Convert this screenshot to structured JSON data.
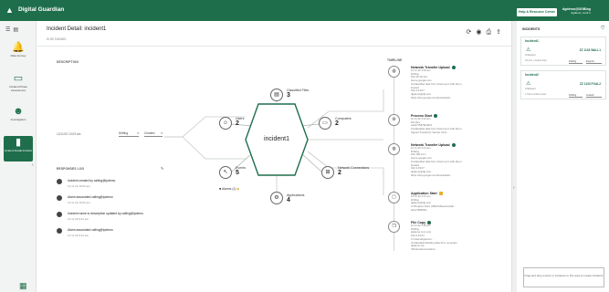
{
  "app": {
    "title": "Digital Guardian",
    "logo_icon": "triangle-logo-icon"
  },
  "topbar": {
    "help_label": "Help & Resource Center",
    "user_name": "dgdemo@DGBlog",
    "user_sub": "dgdemo, Lock 1"
  },
  "nav": {
    "items": [
      {
        "label": "Data Gurvey",
        "icon": "bell-icon"
      },
      {
        "label": "Incident Phase Assessment",
        "icon": "monitor-icon"
      },
      {
        "label": "Investigation",
        "icon": "person-search-icon"
      },
      {
        "label": "Incident Detail Incident",
        "icon": "document-icon"
      }
    ]
  },
  "page": {
    "title": "Incident Detail: incident1",
    "subtitle": "ELSE DANNEL"
  },
  "description": {
    "heading": "DESCRIPTION",
    "date": "12/11/22 10:03 am",
    "owner_select": "Drifting",
    "status_select": "Created"
  },
  "responses": {
    "heading": "RESPONSES LOG",
    "items": [
      {
        "title": "Incident created by calling@ipdemo",
        "date": "12 11 22 10:03 am"
      },
      {
        "title": "Alarm associated calling@ipdemo",
        "date": "12 11 22 10:03 am"
      },
      {
        "title": "Incident name to description updated by calling@ipdemo",
        "date": "12 11 22 9:41 am"
      },
      {
        "title": "Alarm associated calling@ipdemo",
        "date": "12 11 22 9:41 am"
      }
    ]
  },
  "graph": {
    "center": "incident1",
    "nodes": [
      {
        "label": "Classified Files",
        "count": "3",
        "icon": "file-icon"
      },
      {
        "label": "Users",
        "count": "2",
        "icon": "user-icon"
      },
      {
        "label": "Computers",
        "count": "2",
        "icon": "laptop-icon"
      },
      {
        "label": "Events",
        "count": "5",
        "icon": "pointer-icon"
      },
      {
        "label": "Network Connections",
        "count": "2",
        "icon": "network-icon"
      },
      {
        "label": "Applications",
        "count": "4",
        "icon": "gear-icon"
      }
    ],
    "alarms_label": "Alarms (1)"
  },
  "timeline": {
    "heading": "TIMELINE",
    "events": [
      {
        "title": "Network Transfer Upload",
        "icon": "globe-icon",
        "lines": [
          "12 11 22 3:10 am",
          "Drifting",
          "192.40.19.121",
          "Home.google.com",
          "Unclassified data from Cloud sync with dlp.io",
          "Hosted",
          "192.4.13.07",
          "dgdemo@dg.com",
          "https://dev.google.com/downloads/..."
        ]
      },
      {
        "title": "Process Start",
        "icon": "gear-icon",
        "lines": [
          "12 11 22 2:31 am",
          "DG-Dev",
          "cad1775878e40b1",
          "Unclassified data from Cloud sync with dlp.io",
          "Signed Trusted by Vendor Circe"
        ]
      },
      {
        "title": "Network Transfer Upload",
        "icon": "globe-icon",
        "lines": [
          "12 11 22 2:41 am",
          "Drifting",
          "192.100.13.1",
          "Home.google.com",
          "Unclassified data from Cloud sync with dlp.io",
          "Hosted",
          "192.4.15.07",
          "dgdemo@dg.com",
          "https://dev.google.com/downloads/..."
        ]
      },
      {
        "title": "Application Start",
        "icon": "window-icon",
        "lines": [
          "12 11 22 2:37 am",
          "Drifting",
          "dgdemo@dg.com",
          "C:\\Program Files (x86)\\Tableau\\install ...",
          "bdce7982f0b1"
        ]
      },
      {
        "title": "File Copy",
        "icon": "copy-icon",
        "lines": [
          "12 11 22 2:30 am",
          "Drifting",
          "dgdemo.com.com",
          "192.4.15.01",
          "C:\\Users\\dgdemo\\...",
          "Unclassified Existing data from computer",
          "dgdemo.zip",
          "\\\\Shares\\Homeshare\\..."
        ]
      }
    ]
  },
  "incidents_panel": {
    "heading": "INCIDENTS",
    "cards": [
      {
        "name": "Incident1",
        "id_label": "ZZ 1133 WALL1",
        "status_sub": "Unknown",
        "owner": "Drifting",
        "status": "Exports",
        "row_label": "Alt fres, created loan"
      },
      {
        "name": "Incident2",
        "id_label": "ZZ 1133 FOAL2",
        "status_sub": "Unknown",
        "owner": "Drifting",
        "status": "Locked",
        "row_label": "1 Fdex incident plan"
      }
    ],
    "dropzone_text": "Drag and drop events or incidents to this area to create incidents"
  },
  "colors": {
    "brand": "#1f6e4b",
    "accent_yellow": "#e7b024"
  }
}
